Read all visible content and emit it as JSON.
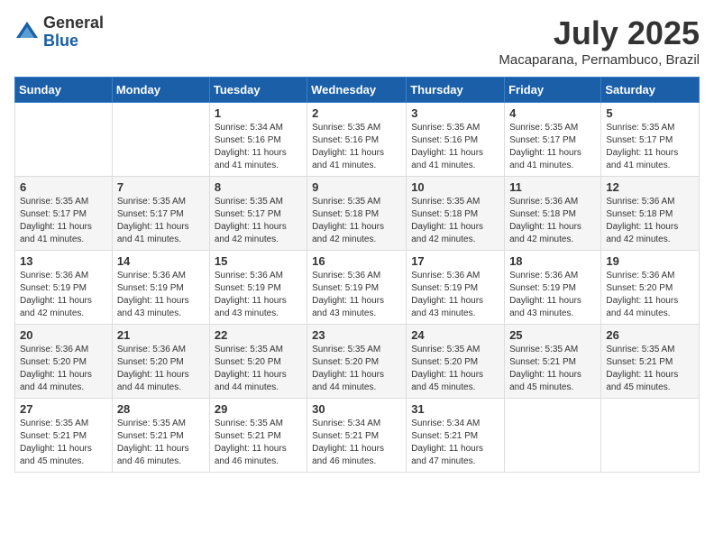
{
  "logo": {
    "general": "General",
    "blue": "Blue"
  },
  "title": {
    "month": "July 2025",
    "location": "Macaparana, Pernambuco, Brazil"
  },
  "weekdays": [
    "Sunday",
    "Monday",
    "Tuesday",
    "Wednesday",
    "Thursday",
    "Friday",
    "Saturday"
  ],
  "weeks": [
    [
      {
        "day": "",
        "info": ""
      },
      {
        "day": "",
        "info": ""
      },
      {
        "day": "1",
        "info": "Sunrise: 5:34 AM\nSunset: 5:16 PM\nDaylight: 11 hours and 41 minutes."
      },
      {
        "day": "2",
        "info": "Sunrise: 5:35 AM\nSunset: 5:16 PM\nDaylight: 11 hours and 41 minutes."
      },
      {
        "day": "3",
        "info": "Sunrise: 5:35 AM\nSunset: 5:16 PM\nDaylight: 11 hours and 41 minutes."
      },
      {
        "day": "4",
        "info": "Sunrise: 5:35 AM\nSunset: 5:17 PM\nDaylight: 11 hours and 41 minutes."
      },
      {
        "day": "5",
        "info": "Sunrise: 5:35 AM\nSunset: 5:17 PM\nDaylight: 11 hours and 41 minutes."
      }
    ],
    [
      {
        "day": "6",
        "info": "Sunrise: 5:35 AM\nSunset: 5:17 PM\nDaylight: 11 hours and 41 minutes."
      },
      {
        "day": "7",
        "info": "Sunrise: 5:35 AM\nSunset: 5:17 PM\nDaylight: 11 hours and 41 minutes."
      },
      {
        "day": "8",
        "info": "Sunrise: 5:35 AM\nSunset: 5:17 PM\nDaylight: 11 hours and 42 minutes."
      },
      {
        "day": "9",
        "info": "Sunrise: 5:35 AM\nSunset: 5:18 PM\nDaylight: 11 hours and 42 minutes."
      },
      {
        "day": "10",
        "info": "Sunrise: 5:35 AM\nSunset: 5:18 PM\nDaylight: 11 hours and 42 minutes."
      },
      {
        "day": "11",
        "info": "Sunrise: 5:36 AM\nSunset: 5:18 PM\nDaylight: 11 hours and 42 minutes."
      },
      {
        "day": "12",
        "info": "Sunrise: 5:36 AM\nSunset: 5:18 PM\nDaylight: 11 hours and 42 minutes."
      }
    ],
    [
      {
        "day": "13",
        "info": "Sunrise: 5:36 AM\nSunset: 5:19 PM\nDaylight: 11 hours and 42 minutes."
      },
      {
        "day": "14",
        "info": "Sunrise: 5:36 AM\nSunset: 5:19 PM\nDaylight: 11 hours and 43 minutes."
      },
      {
        "day": "15",
        "info": "Sunrise: 5:36 AM\nSunset: 5:19 PM\nDaylight: 11 hours and 43 minutes."
      },
      {
        "day": "16",
        "info": "Sunrise: 5:36 AM\nSunset: 5:19 PM\nDaylight: 11 hours and 43 minutes."
      },
      {
        "day": "17",
        "info": "Sunrise: 5:36 AM\nSunset: 5:19 PM\nDaylight: 11 hours and 43 minutes."
      },
      {
        "day": "18",
        "info": "Sunrise: 5:36 AM\nSunset: 5:19 PM\nDaylight: 11 hours and 43 minutes."
      },
      {
        "day": "19",
        "info": "Sunrise: 5:36 AM\nSunset: 5:20 PM\nDaylight: 11 hours and 44 minutes."
      }
    ],
    [
      {
        "day": "20",
        "info": "Sunrise: 5:36 AM\nSunset: 5:20 PM\nDaylight: 11 hours and 44 minutes."
      },
      {
        "day": "21",
        "info": "Sunrise: 5:36 AM\nSunset: 5:20 PM\nDaylight: 11 hours and 44 minutes."
      },
      {
        "day": "22",
        "info": "Sunrise: 5:35 AM\nSunset: 5:20 PM\nDaylight: 11 hours and 44 minutes."
      },
      {
        "day": "23",
        "info": "Sunrise: 5:35 AM\nSunset: 5:20 PM\nDaylight: 11 hours and 44 minutes."
      },
      {
        "day": "24",
        "info": "Sunrise: 5:35 AM\nSunset: 5:20 PM\nDaylight: 11 hours and 45 minutes."
      },
      {
        "day": "25",
        "info": "Sunrise: 5:35 AM\nSunset: 5:21 PM\nDaylight: 11 hours and 45 minutes."
      },
      {
        "day": "26",
        "info": "Sunrise: 5:35 AM\nSunset: 5:21 PM\nDaylight: 11 hours and 45 minutes."
      }
    ],
    [
      {
        "day": "27",
        "info": "Sunrise: 5:35 AM\nSunset: 5:21 PM\nDaylight: 11 hours and 45 minutes."
      },
      {
        "day": "28",
        "info": "Sunrise: 5:35 AM\nSunset: 5:21 PM\nDaylight: 11 hours and 46 minutes."
      },
      {
        "day": "29",
        "info": "Sunrise: 5:35 AM\nSunset: 5:21 PM\nDaylight: 11 hours and 46 minutes."
      },
      {
        "day": "30",
        "info": "Sunrise: 5:34 AM\nSunset: 5:21 PM\nDaylight: 11 hours and 46 minutes."
      },
      {
        "day": "31",
        "info": "Sunrise: 5:34 AM\nSunset: 5:21 PM\nDaylight: 11 hours and 47 minutes."
      },
      {
        "day": "",
        "info": ""
      },
      {
        "day": "",
        "info": ""
      }
    ]
  ]
}
